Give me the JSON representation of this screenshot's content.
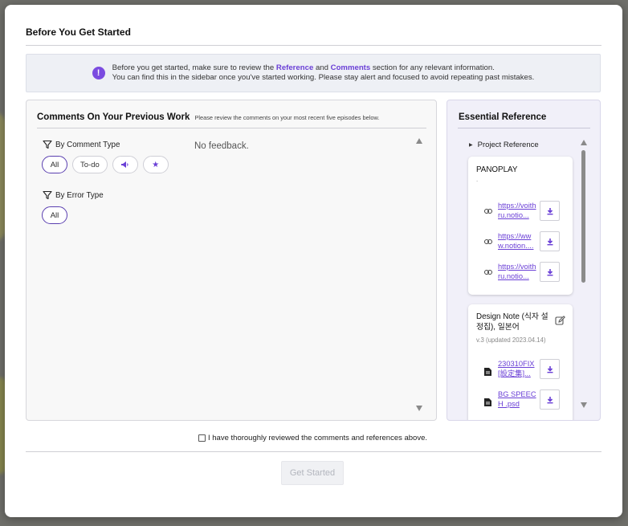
{
  "colors": {
    "accent": "#6a3fd6",
    "overlay": "#6f6f6a"
  },
  "modal": {
    "title": "Before You Get Started",
    "banner": {
      "line1_pre": "Before you get started, make sure to review the ",
      "reference_word": "Reference",
      "and_word": " and ",
      "comments_word": "Comments",
      "line1_post": " section for any relevant information.",
      "line2": "You can find this in the sidebar once you've started working. Please stay alert and focused to avoid repeating past mistakes."
    },
    "comments_panel": {
      "title": "Comments On Your Previous Work",
      "subtitle": "Please review the comments on your most recent five episodes below.",
      "comment_type_label": "By Comment Type",
      "comment_type_chips": [
        "All",
        "To-do",
        "megaphone-icon",
        "star-icon"
      ],
      "error_type_label": "By Error Type",
      "error_type_chips": [
        "All"
      ],
      "empty_text": "No feedback."
    },
    "reference_panel": {
      "title": "Essential Reference",
      "section_label": "Project Reference",
      "cards": [
        {
          "title": "PANOPLAY",
          "subtitle": ".",
          "links": [
            "https://voithru.notio...",
            "https://www.notion....",
            "https://voithru.notio..."
          ]
        },
        {
          "title": "Design Note (식자 설정집), 일본어",
          "subtitle": "v.3 (updated 2023.04.14)",
          "files": [
            "230310FIX [設定集]...",
            "BG SPEECH .psd"
          ]
        }
      ]
    },
    "confirm_label": "I have thoroughly reviewed the comments and references above.",
    "start_button": "Get Started"
  }
}
